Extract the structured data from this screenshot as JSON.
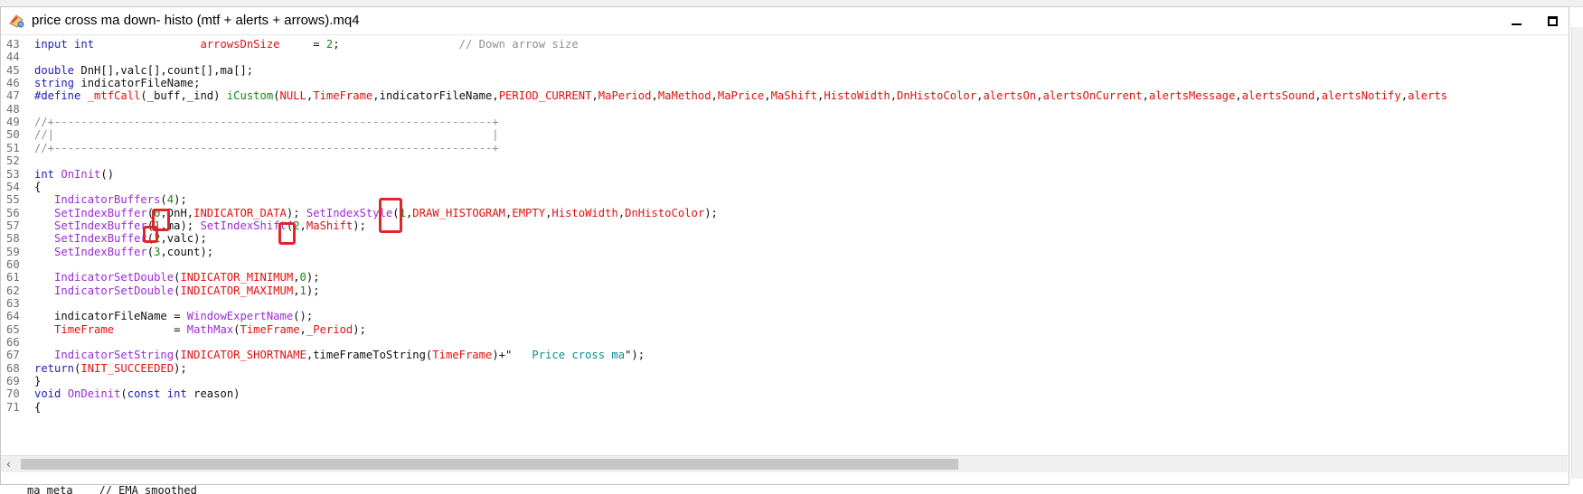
{
  "window": {
    "title": "price cross ma down-  histo (mtf + alerts + arrows).mq4",
    "icon": "mql-file-icon",
    "controls": [
      "minimize-icon",
      "maximize-icon"
    ]
  },
  "colors": {
    "keyword": "#1d1db6",
    "function": "#9b2bd6",
    "constant": "#e01010",
    "number": "#128a12",
    "comment": "#909090",
    "string": "#0c8c8c",
    "highlight_box": "#e0262b"
  },
  "lines": [
    {
      "n": "43",
      "tokens": [
        [
          "kw",
          "input int"
        ],
        [
          "tx",
          "                "
        ],
        [
          "cs",
          "arrowsDnSize"
        ],
        [
          "tx",
          "     = "
        ],
        [
          "nm",
          "2"
        ],
        [
          "tx",
          ";                  "
        ],
        [
          "cm",
          "// Down arrow size"
        ]
      ]
    },
    {
      "n": "44",
      "tokens": []
    },
    {
      "n": "45",
      "tokens": [
        [
          "kw",
          "double"
        ],
        [
          "tx",
          " DnH[],valc[],count[],ma[];"
        ]
      ]
    },
    {
      "n": "46",
      "tokens": [
        [
          "kw",
          "string"
        ],
        [
          "tx",
          " indicatorFileName;"
        ]
      ]
    },
    {
      "n": "47",
      "tokens": [
        [
          "kw",
          "#define"
        ],
        [
          "tx",
          " "
        ],
        [
          "cs",
          "_mtfCall"
        ],
        [
          "tx",
          "(_buff,_ind) "
        ],
        [
          "nm",
          "iCustom"
        ],
        [
          "tx",
          "("
        ],
        [
          "cs",
          "NULL"
        ],
        [
          "tx",
          ","
        ],
        [
          "cs",
          "TimeFrame"
        ],
        [
          "tx",
          ",indicatorFileName,"
        ],
        [
          "cs",
          "PERIOD_CURRENT"
        ],
        [
          "tx",
          ","
        ],
        [
          "cs",
          "MaPeriod"
        ],
        [
          "tx",
          ","
        ],
        [
          "cs",
          "MaMethod"
        ],
        [
          "tx",
          ","
        ],
        [
          "cs",
          "MaPrice"
        ],
        [
          "tx",
          ","
        ],
        [
          "cs",
          "MaShift"
        ],
        [
          "tx",
          ","
        ],
        [
          "cs",
          "HistoWidth"
        ],
        [
          "tx",
          ","
        ],
        [
          "cs",
          "DnHistoColor"
        ],
        [
          "tx",
          ","
        ],
        [
          "cs",
          "alertsOn"
        ],
        [
          "tx",
          ","
        ],
        [
          "cs",
          "alertsOnCurrent"
        ],
        [
          "tx",
          ","
        ],
        [
          "cs",
          "alertsMessage"
        ],
        [
          "tx",
          ","
        ],
        [
          "cs",
          "alertsSound"
        ],
        [
          "tx",
          ","
        ],
        [
          "cs",
          "alertsNotify"
        ],
        [
          "tx",
          ","
        ],
        [
          "cs",
          "alerts"
        ]
      ]
    },
    {
      "n": "48",
      "tokens": []
    },
    {
      "n": "49",
      "tokens": [
        [
          "cm",
          "//+------------------------------------------------------------------+"
        ]
      ]
    },
    {
      "n": "50",
      "tokens": [
        [
          "cm",
          "//|                                                                  |"
        ]
      ]
    },
    {
      "n": "51",
      "tokens": [
        [
          "cm",
          "//+------------------------------------------------------------------+"
        ]
      ]
    },
    {
      "n": "52",
      "tokens": []
    },
    {
      "n": "53",
      "tokens": [
        [
          "kw",
          "int"
        ],
        [
          "tx",
          " "
        ],
        [
          "fn",
          "OnInit"
        ],
        [
          "tx",
          "()"
        ]
      ]
    },
    {
      "n": "54",
      "tokens": [
        [
          "tx",
          "{"
        ]
      ]
    },
    {
      "n": "55",
      "tokens": [
        [
          "tx",
          "   "
        ],
        [
          "fn",
          "IndicatorBuffers"
        ],
        [
          "tx",
          "("
        ],
        [
          "nm",
          "4"
        ],
        [
          "tx",
          ");"
        ]
      ]
    },
    {
      "n": "56",
      "tokens": [
        [
          "tx",
          "   "
        ],
        [
          "fn",
          "SetIndexBuffer"
        ],
        [
          "tx",
          "("
        ],
        [
          "nm",
          "0"
        ],
        [
          "tx",
          ",DnH,"
        ],
        [
          "cs",
          "INDICATOR_DATA"
        ],
        [
          "tx",
          "); "
        ],
        [
          "fn",
          "SetIndexStyle"
        ],
        [
          "tx",
          "("
        ],
        [
          "nm",
          "1"
        ],
        [
          "tx",
          ","
        ],
        [
          "cs",
          "DRAW_HISTOGRAM"
        ],
        [
          "tx",
          ","
        ],
        [
          "cs",
          "EMPTY"
        ],
        [
          "tx",
          ","
        ],
        [
          "cs",
          "HistoWidth"
        ],
        [
          "tx",
          ","
        ],
        [
          "cs",
          "DnHistoColor"
        ],
        [
          "tx",
          ");"
        ]
      ]
    },
    {
      "n": "57",
      "tokens": [
        [
          "tx",
          "   "
        ],
        [
          "fn",
          "SetIndexBuffer"
        ],
        [
          "tx",
          "("
        ],
        [
          "nm",
          "1"
        ],
        [
          "tx",
          ",ma); "
        ],
        [
          "fn",
          "SetIndexShift"
        ],
        [
          "tx",
          "("
        ],
        [
          "nm",
          "2"
        ],
        [
          "tx",
          ","
        ],
        [
          "cs",
          "MaShift"
        ],
        [
          "tx",
          ");"
        ]
      ]
    },
    {
      "n": "58",
      "tokens": [
        [
          "tx",
          "   "
        ],
        [
          "fn",
          "SetIndexBuffer"
        ],
        [
          "tx",
          "("
        ],
        [
          "nm",
          "2"
        ],
        [
          "tx",
          ",valc);"
        ]
      ]
    },
    {
      "n": "59",
      "tokens": [
        [
          "tx",
          "   "
        ],
        [
          "fn",
          "SetIndexBuffer"
        ],
        [
          "tx",
          "("
        ],
        [
          "nm",
          "3"
        ],
        [
          "tx",
          ",count);"
        ]
      ]
    },
    {
      "n": "60",
      "tokens": []
    },
    {
      "n": "61",
      "tokens": [
        [
          "tx",
          "   "
        ],
        [
          "fn",
          "IndicatorSetDouble"
        ],
        [
          "tx",
          "("
        ],
        [
          "cs",
          "INDICATOR_MINIMUM"
        ],
        [
          "tx",
          ","
        ],
        [
          "nm",
          "0"
        ],
        [
          "tx",
          ");"
        ]
      ]
    },
    {
      "n": "62",
      "tokens": [
        [
          "tx",
          "   "
        ],
        [
          "fn",
          "IndicatorSetDouble"
        ],
        [
          "tx",
          "("
        ],
        [
          "cs",
          "INDICATOR_MAXIMUM"
        ],
        [
          "tx",
          ","
        ],
        [
          "nm",
          "1"
        ],
        [
          "tx",
          ");"
        ]
      ]
    },
    {
      "n": "63",
      "tokens": []
    },
    {
      "n": "64",
      "tokens": [
        [
          "tx",
          "   indicatorFileName = "
        ],
        [
          "fn",
          "WindowExpertName"
        ],
        [
          "tx",
          "();"
        ]
      ]
    },
    {
      "n": "65",
      "tokens": [
        [
          "tx",
          "   "
        ],
        [
          "cs",
          "TimeFrame"
        ],
        [
          "tx",
          "         = "
        ],
        [
          "fn",
          "MathMax"
        ],
        [
          "tx",
          "("
        ],
        [
          "cs",
          "TimeFrame"
        ],
        [
          "tx",
          ","
        ],
        [
          "cs",
          "_Period"
        ],
        [
          "tx",
          ");"
        ]
      ]
    },
    {
      "n": "66",
      "tokens": []
    },
    {
      "n": "67",
      "tokens": [
        [
          "tx",
          "   "
        ],
        [
          "fn",
          "IndicatorSetString"
        ],
        [
          "tx",
          "("
        ],
        [
          "cs",
          "INDICATOR_SHORTNAME"
        ],
        [
          "tx",
          ",timeFrameToString("
        ],
        [
          "cs",
          "TimeFrame"
        ],
        [
          "tx",
          ")+\"   "
        ],
        [
          "st",
          "Price cross ma"
        ],
        [
          "tx",
          "\");"
        ]
      ]
    },
    {
      "n": "68",
      "tokens": [
        [
          "kw",
          "return"
        ],
        [
          "tx",
          "("
        ],
        [
          "cs",
          "INIT_SUCCEEDED"
        ],
        [
          "tx",
          ");"
        ]
      ]
    },
    {
      "n": "69",
      "tokens": [
        [
          "tx",
          "}"
        ]
      ]
    },
    {
      "n": "70",
      "tokens": [
        [
          "kw",
          "void"
        ],
        [
          "tx",
          " "
        ],
        [
          "fn",
          "OnDeinit"
        ],
        [
          "tx",
          "("
        ],
        [
          "kw",
          "const int"
        ],
        [
          "tx",
          " reason)"
        ]
      ]
    },
    {
      "n": "71",
      "tokens": [
        [
          "tx",
          "{"
        ]
      ]
    }
  ],
  "partial_bottom_line": "ma_meta    // EMA smoothed",
  "highlights": [
    {
      "line": "56",
      "target": "0"
    },
    {
      "line": "56",
      "target": "1"
    },
    {
      "line": "57",
      "target": "1"
    },
    {
      "line": "57",
      "target": "2"
    }
  ],
  "scrollbar": {
    "left_arrow": "‹",
    "thumb_fraction": 0.61
  }
}
